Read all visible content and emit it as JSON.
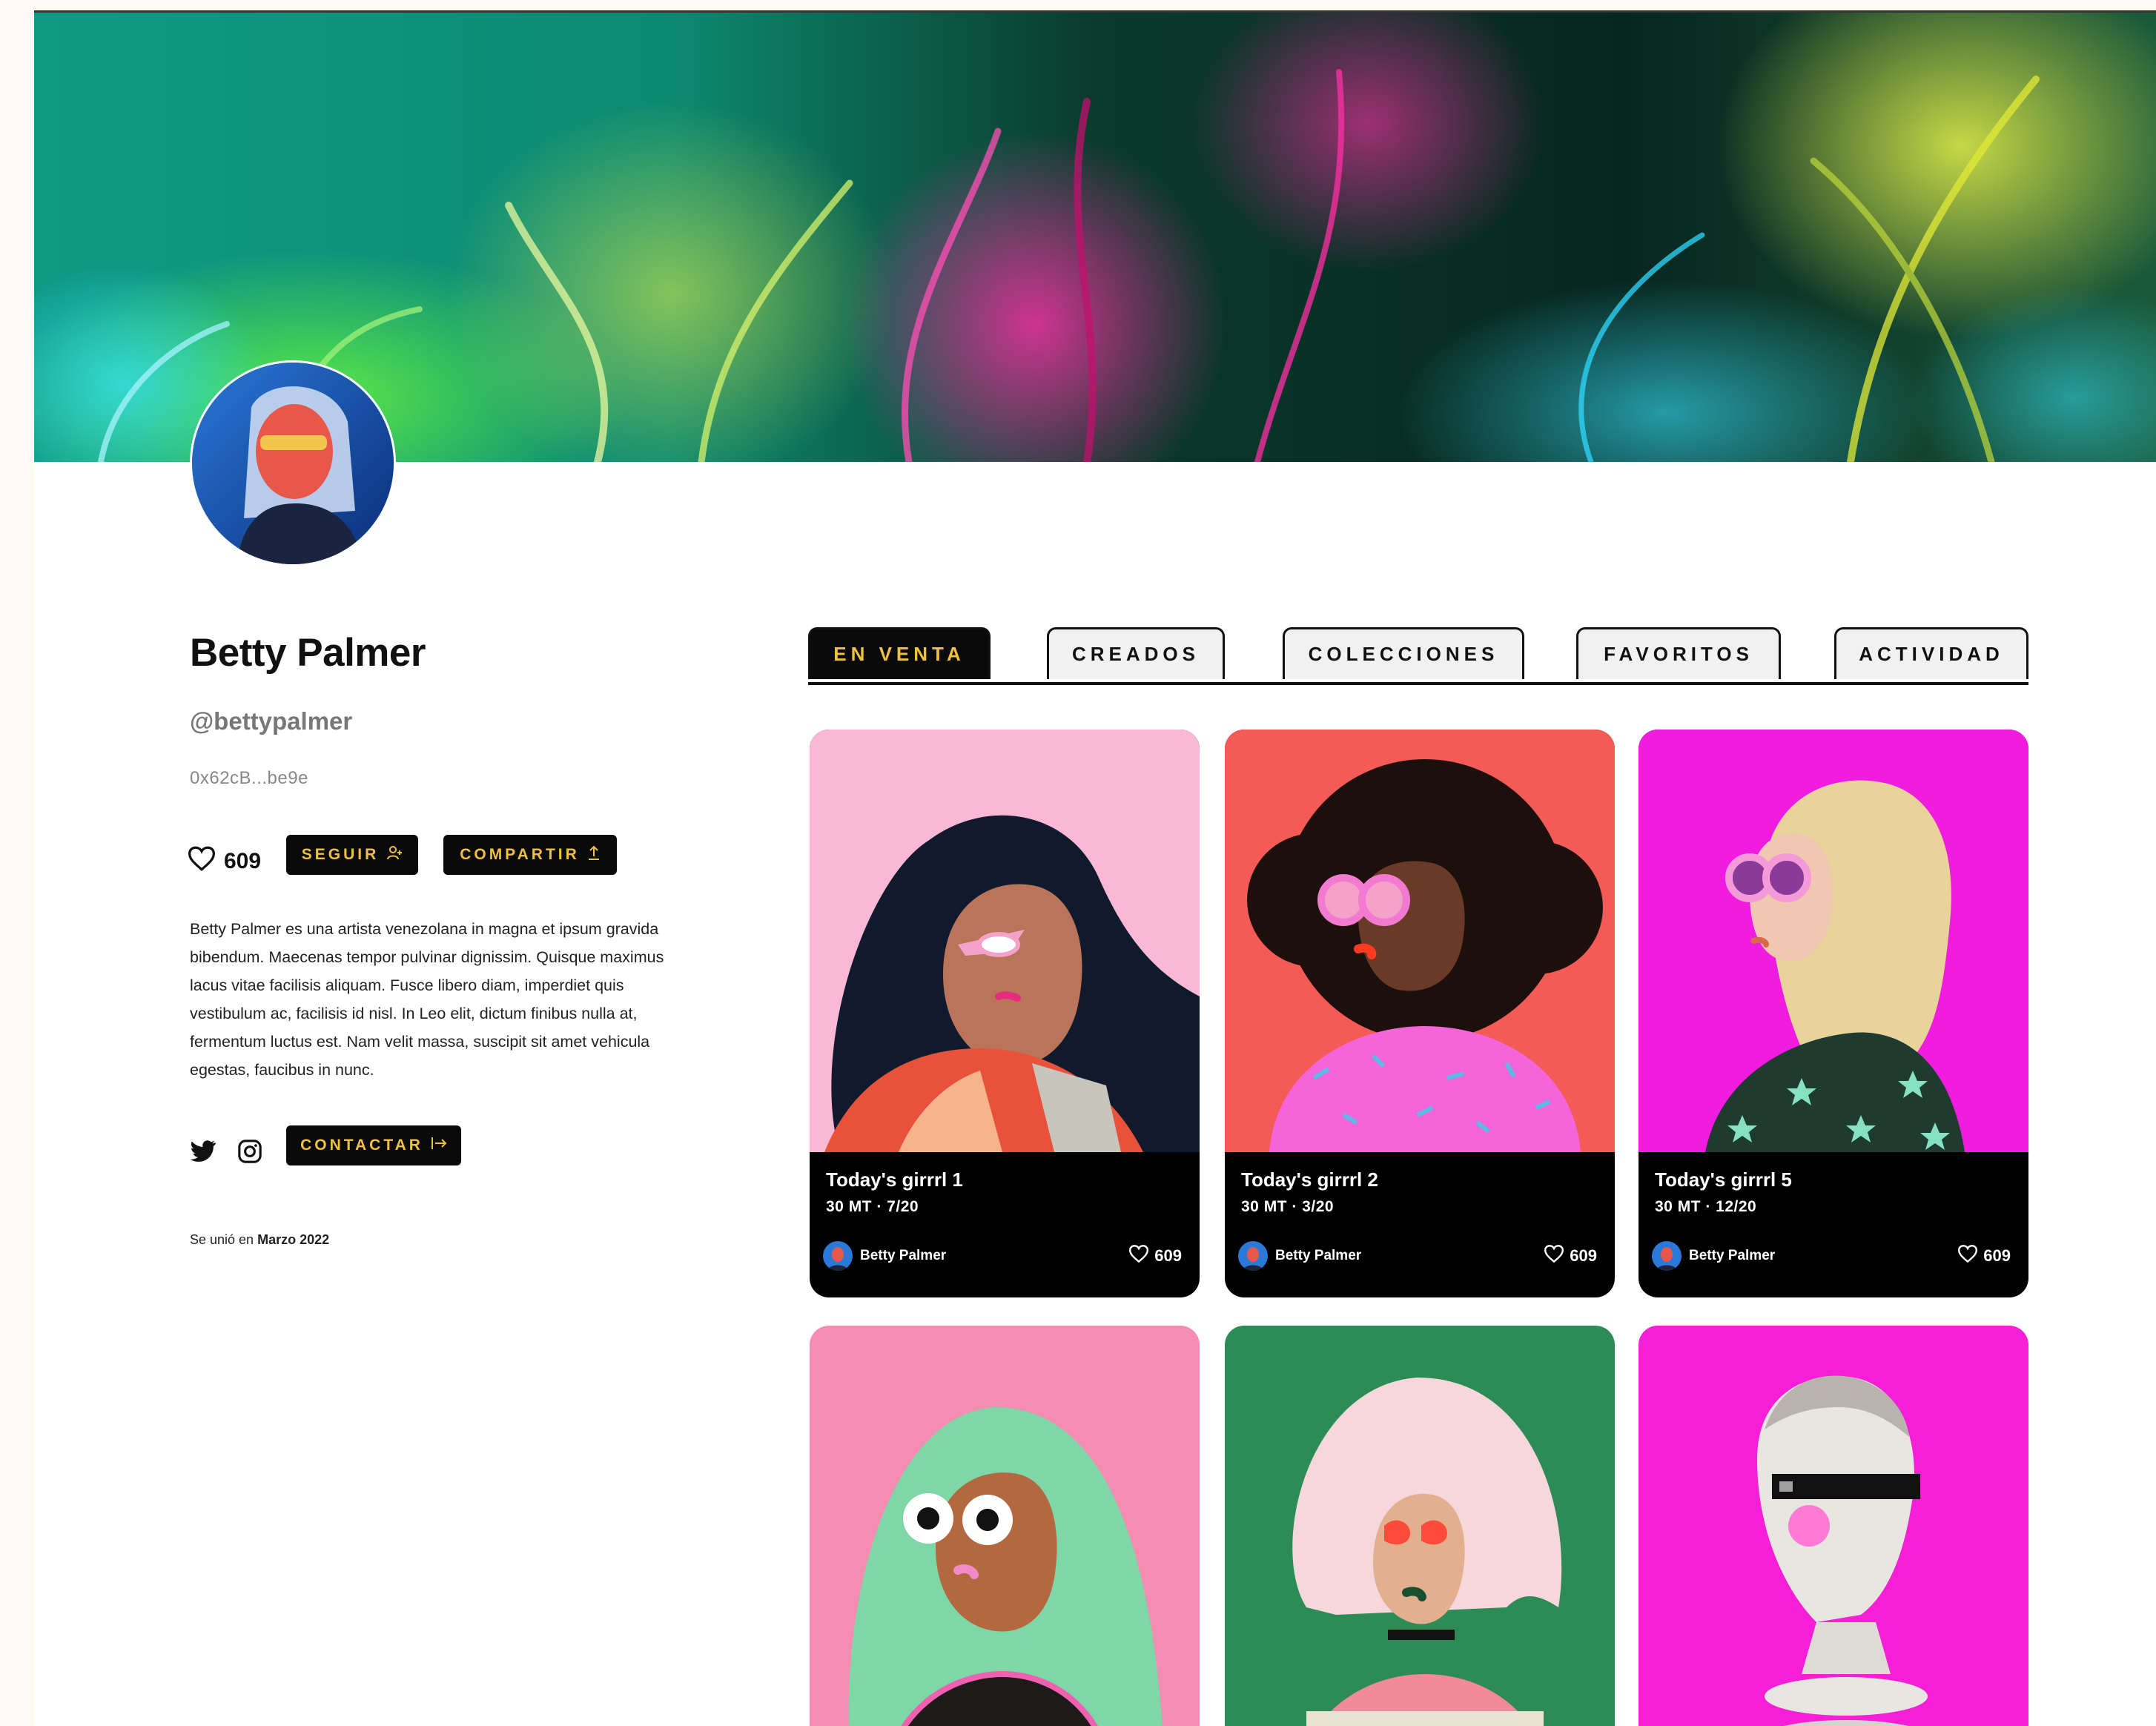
{
  "profile": {
    "name": "Betty Palmer",
    "handle": "@bettypalmer",
    "wallet": "0x62cB...be9e",
    "likes": "609",
    "follow_label": "SEGUIR",
    "share_label": "COMPARTIR",
    "contact_label": "CONTACTAR",
    "bio": "Betty Palmer es una artista venezolana in magna et ipsum gravida bibendum. Maecenas tempor pulvinar dignissim. Quisque maximus lacus vitae facilisis aliquam. Fusce libero diam, imperdiet quis vestibulum ac, facilisis id nisl. In Leo elit, dictum finibus nulla at, fermentum luctus est. Nam velit massa, suscipit sit amet vehicula egestas, faucibus in nunc.",
    "joined_prefix": "Se unió en",
    "joined_date": "Marzo 2022"
  },
  "tabs": [
    {
      "label": "EN VENTA",
      "active": true
    },
    {
      "label": "CREADOS",
      "active": false
    },
    {
      "label": "COLECCIONES",
      "active": false
    },
    {
      "label": "FAVORITOS",
      "active": false
    },
    {
      "label": "ACTIVIDAD",
      "active": false
    }
  ],
  "cards": [
    {
      "title": "Today's girrrl 1",
      "meta": "30 MT · 7/20",
      "author": "Betty Palmer",
      "likes": "609",
      "bg": "#f9b9d4"
    },
    {
      "title": "Today's girrrl 2",
      "meta": "30 MT · 3/20",
      "author": "Betty Palmer",
      "likes": "609",
      "bg": "#f45a56"
    },
    {
      "title": "Today's girrrl 5",
      "meta": "30 MT · 12/20",
      "author": "Betty Palmer",
      "likes": "609",
      "bg": "#f01ce0"
    }
  ],
  "cards_row2": [
    {
      "bg": "#f48db1"
    },
    {
      "bg": "#2d8b55"
    },
    {
      "bg": "#f51fd8"
    }
  ],
  "colors": {
    "accent_gold": "#f0c040",
    "button_dark": "#0a0a0a"
  },
  "icons": {
    "heart": "heart-icon",
    "follow": "add-user-icon",
    "share": "share-icon",
    "contact": "contact-arrow-icon",
    "twitter": "twitter-icon",
    "instagram": "instagram-icon"
  }
}
